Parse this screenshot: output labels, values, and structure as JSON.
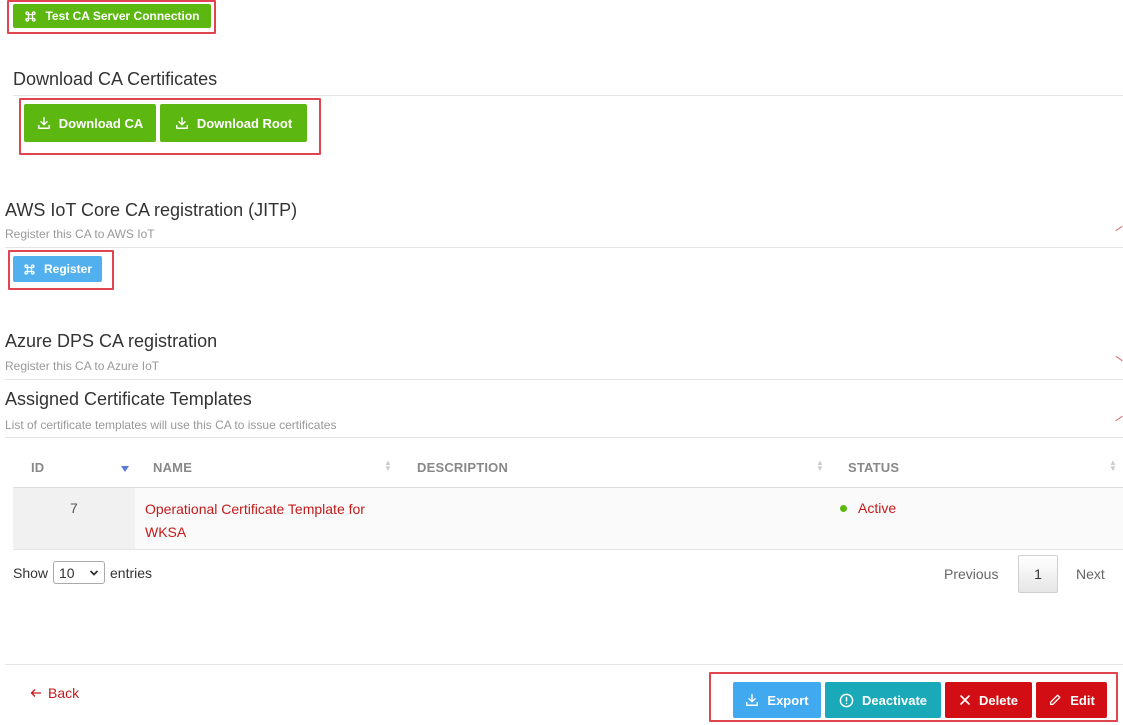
{
  "test_connection": {
    "label": "Test CA Server Connection"
  },
  "download": {
    "title": "Download CA Certificates",
    "download_ca": "Download CA",
    "download_root": "Download Root"
  },
  "aws": {
    "title": "AWS IoT Core CA registration (JITP)",
    "subtitle": "Register this CA to AWS IoT",
    "register": "Register"
  },
  "azure": {
    "title": "Azure DPS CA registration",
    "subtitle": "Register this CA to Azure IoT"
  },
  "templates": {
    "title": "Assigned Certificate Templates",
    "subtitle": "List of certificate templates will use this CA to issue certificates",
    "columns": {
      "id": "ID",
      "name": "NAME",
      "description": "DESCRIPTION",
      "status": "STATUS"
    },
    "rows": [
      {
        "id": "7",
        "name_line1": "Operational Certificate Template for",
        "name_line2": "WKSA",
        "description": "",
        "status": "Active"
      }
    ],
    "show_label": "Show",
    "page_size": "10",
    "entries_label": "entries",
    "previous": "Previous",
    "page": "1",
    "next": "Next"
  },
  "footer": {
    "back": "Back",
    "export": "Export",
    "deactivate": "Deactivate",
    "delete": "Delete",
    "edit": "Edit"
  },
  "colors": {
    "green": "#5cb811",
    "blue": "#40a9ef",
    "teal": "#1aa9b8",
    "red": "#d20e14",
    "link_red": "#c41a1a",
    "active_green": "#5cb811"
  }
}
